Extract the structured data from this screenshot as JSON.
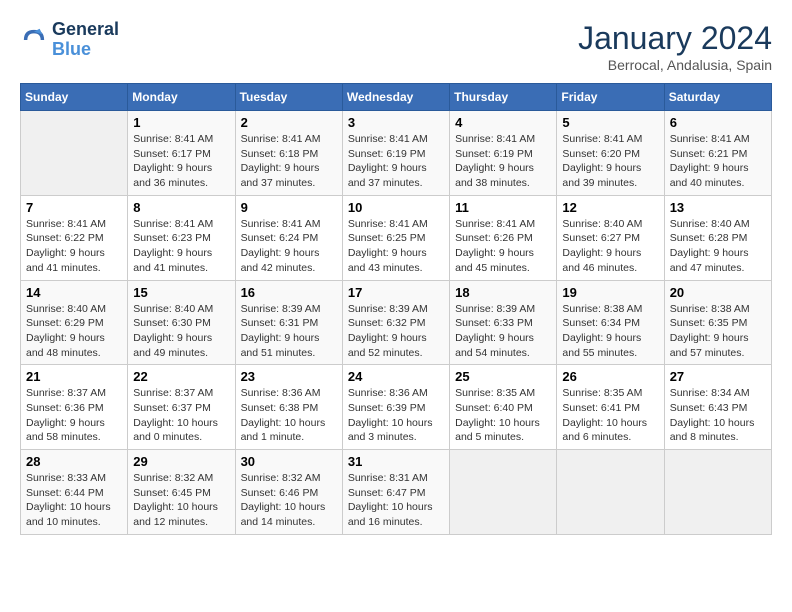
{
  "logo": {
    "line1": "General",
    "line2": "Blue"
  },
  "title": "January 2024",
  "subtitle": "Berrocal, Andalusia, Spain",
  "days_of_week": [
    "Sunday",
    "Monday",
    "Tuesday",
    "Wednesday",
    "Thursday",
    "Friday",
    "Saturday"
  ],
  "weeks": [
    [
      {
        "num": "",
        "empty": true
      },
      {
        "num": "1",
        "sunrise": "Sunrise: 8:41 AM",
        "sunset": "Sunset: 6:17 PM",
        "daylight": "Daylight: 9 hours and 36 minutes."
      },
      {
        "num": "2",
        "sunrise": "Sunrise: 8:41 AM",
        "sunset": "Sunset: 6:18 PM",
        "daylight": "Daylight: 9 hours and 37 minutes."
      },
      {
        "num": "3",
        "sunrise": "Sunrise: 8:41 AM",
        "sunset": "Sunset: 6:19 PM",
        "daylight": "Daylight: 9 hours and 37 minutes."
      },
      {
        "num": "4",
        "sunrise": "Sunrise: 8:41 AM",
        "sunset": "Sunset: 6:19 PM",
        "daylight": "Daylight: 9 hours and 38 minutes."
      },
      {
        "num": "5",
        "sunrise": "Sunrise: 8:41 AM",
        "sunset": "Sunset: 6:20 PM",
        "daylight": "Daylight: 9 hours and 39 minutes."
      },
      {
        "num": "6",
        "sunrise": "Sunrise: 8:41 AM",
        "sunset": "Sunset: 6:21 PM",
        "daylight": "Daylight: 9 hours and 40 minutes."
      }
    ],
    [
      {
        "num": "7",
        "sunrise": "Sunrise: 8:41 AM",
        "sunset": "Sunset: 6:22 PM",
        "daylight": "Daylight: 9 hours and 41 minutes."
      },
      {
        "num": "8",
        "sunrise": "Sunrise: 8:41 AM",
        "sunset": "Sunset: 6:23 PM",
        "daylight": "Daylight: 9 hours and 41 minutes."
      },
      {
        "num": "9",
        "sunrise": "Sunrise: 8:41 AM",
        "sunset": "Sunset: 6:24 PM",
        "daylight": "Daylight: 9 hours and 42 minutes."
      },
      {
        "num": "10",
        "sunrise": "Sunrise: 8:41 AM",
        "sunset": "Sunset: 6:25 PM",
        "daylight": "Daylight: 9 hours and 43 minutes."
      },
      {
        "num": "11",
        "sunrise": "Sunrise: 8:41 AM",
        "sunset": "Sunset: 6:26 PM",
        "daylight": "Daylight: 9 hours and 45 minutes."
      },
      {
        "num": "12",
        "sunrise": "Sunrise: 8:40 AM",
        "sunset": "Sunset: 6:27 PM",
        "daylight": "Daylight: 9 hours and 46 minutes."
      },
      {
        "num": "13",
        "sunrise": "Sunrise: 8:40 AM",
        "sunset": "Sunset: 6:28 PM",
        "daylight": "Daylight: 9 hours and 47 minutes."
      }
    ],
    [
      {
        "num": "14",
        "sunrise": "Sunrise: 8:40 AM",
        "sunset": "Sunset: 6:29 PM",
        "daylight": "Daylight: 9 hours and 48 minutes."
      },
      {
        "num": "15",
        "sunrise": "Sunrise: 8:40 AM",
        "sunset": "Sunset: 6:30 PM",
        "daylight": "Daylight: 9 hours and 49 minutes."
      },
      {
        "num": "16",
        "sunrise": "Sunrise: 8:39 AM",
        "sunset": "Sunset: 6:31 PM",
        "daylight": "Daylight: 9 hours and 51 minutes."
      },
      {
        "num": "17",
        "sunrise": "Sunrise: 8:39 AM",
        "sunset": "Sunset: 6:32 PM",
        "daylight": "Daylight: 9 hours and 52 minutes."
      },
      {
        "num": "18",
        "sunrise": "Sunrise: 8:39 AM",
        "sunset": "Sunset: 6:33 PM",
        "daylight": "Daylight: 9 hours and 54 minutes."
      },
      {
        "num": "19",
        "sunrise": "Sunrise: 8:38 AM",
        "sunset": "Sunset: 6:34 PM",
        "daylight": "Daylight: 9 hours and 55 minutes."
      },
      {
        "num": "20",
        "sunrise": "Sunrise: 8:38 AM",
        "sunset": "Sunset: 6:35 PM",
        "daylight": "Daylight: 9 hours and 57 minutes."
      }
    ],
    [
      {
        "num": "21",
        "sunrise": "Sunrise: 8:37 AM",
        "sunset": "Sunset: 6:36 PM",
        "daylight": "Daylight: 9 hours and 58 minutes."
      },
      {
        "num": "22",
        "sunrise": "Sunrise: 8:37 AM",
        "sunset": "Sunset: 6:37 PM",
        "daylight": "Daylight: 10 hours and 0 minutes."
      },
      {
        "num": "23",
        "sunrise": "Sunrise: 8:36 AM",
        "sunset": "Sunset: 6:38 PM",
        "daylight": "Daylight: 10 hours and 1 minute."
      },
      {
        "num": "24",
        "sunrise": "Sunrise: 8:36 AM",
        "sunset": "Sunset: 6:39 PM",
        "daylight": "Daylight: 10 hours and 3 minutes."
      },
      {
        "num": "25",
        "sunrise": "Sunrise: 8:35 AM",
        "sunset": "Sunset: 6:40 PM",
        "daylight": "Daylight: 10 hours and 5 minutes."
      },
      {
        "num": "26",
        "sunrise": "Sunrise: 8:35 AM",
        "sunset": "Sunset: 6:41 PM",
        "daylight": "Daylight: 10 hours and 6 minutes."
      },
      {
        "num": "27",
        "sunrise": "Sunrise: 8:34 AM",
        "sunset": "Sunset: 6:43 PM",
        "daylight": "Daylight: 10 hours and 8 minutes."
      }
    ],
    [
      {
        "num": "28",
        "sunrise": "Sunrise: 8:33 AM",
        "sunset": "Sunset: 6:44 PM",
        "daylight": "Daylight: 10 hours and 10 minutes."
      },
      {
        "num": "29",
        "sunrise": "Sunrise: 8:32 AM",
        "sunset": "Sunset: 6:45 PM",
        "daylight": "Daylight: 10 hours and 12 minutes."
      },
      {
        "num": "30",
        "sunrise": "Sunrise: 8:32 AM",
        "sunset": "Sunset: 6:46 PM",
        "daylight": "Daylight: 10 hours and 14 minutes."
      },
      {
        "num": "31",
        "sunrise": "Sunrise: 8:31 AM",
        "sunset": "Sunset: 6:47 PM",
        "daylight": "Daylight: 10 hours and 16 minutes."
      },
      {
        "num": "",
        "empty": true
      },
      {
        "num": "",
        "empty": true
      },
      {
        "num": "",
        "empty": true
      }
    ]
  ]
}
